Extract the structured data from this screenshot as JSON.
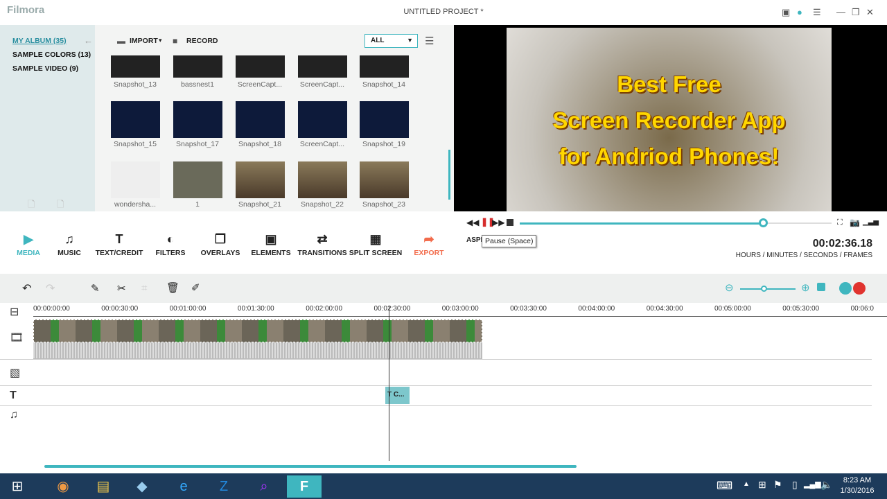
{
  "app": {
    "logo": "Filmora",
    "title": "UNTITLED PROJECT *"
  },
  "sidebar": {
    "items": [
      {
        "label": "MY ALBUM (35)"
      },
      {
        "label": "SAMPLE COLORS (13)"
      },
      {
        "label": "SAMPLE VIDEO (9)"
      }
    ]
  },
  "media": {
    "import_label": "IMPORT",
    "record_label": "RECORD",
    "filter_value": "ALL",
    "items": [
      {
        "label": "Snapshot_13"
      },
      {
        "label": "bassnest1"
      },
      {
        "label": "ScreenCapt..."
      },
      {
        "label": "ScreenCapt..."
      },
      {
        "label": "Snapshot_14"
      },
      {
        "label": "Snapshot_15"
      },
      {
        "label": "Snapshot_17"
      },
      {
        "label": "Snapshot_18"
      },
      {
        "label": "ScreenCapt..."
      },
      {
        "label": "Snapshot_19"
      },
      {
        "label": "wondersha..."
      },
      {
        "label": "1"
      },
      {
        "label": "Snapshot_21"
      },
      {
        "label": "Snapshot_22"
      },
      {
        "label": "Snapshot_23"
      }
    ]
  },
  "preview": {
    "line1": "Best Free",
    "line2": "Screen Recorder App",
    "line3": "for Andriod Phones!",
    "progress": 0.78
  },
  "playback": {
    "aspect_label": "ASPE",
    "tooltip": "Pause (Space)",
    "timecode": "00:02:36.18",
    "timecode_label": "HOURS / MINUTES / SECONDS / FRAMES"
  },
  "tools": [
    {
      "label": "MEDIA",
      "icon": "▶"
    },
    {
      "label": "MUSIC",
      "icon": "♫"
    },
    {
      "label": "TEXT/CREDIT",
      "icon": "T"
    },
    {
      "label": "FILTERS",
      "icon": "◐"
    },
    {
      "label": "OVERLAYS",
      "icon": "❐"
    },
    {
      "label": "ELEMENTS",
      "icon": "▣"
    },
    {
      "label": "TRANSITIONS",
      "icon": "⇄"
    },
    {
      "label": "SPLIT SCREEN",
      "icon": "▦"
    },
    {
      "label": "EXPORT",
      "icon": "➦"
    }
  ],
  "ruler": [
    "00:00:00:00",
    "00:00:30:00",
    "00:01:00:00",
    "00:01:30:00",
    "00:02:00:00",
    "00:02:30:00",
    "00:03:00:00",
    "00:03:30:00",
    "00:04:00:00",
    "00:04:30:00",
    "00:05:00:00",
    "00:05:30:00",
    "00:06:0"
  ],
  "text_clip": "T C...",
  "taskbar": {
    "time": "8:23 AM",
    "date": "1/30/2016"
  },
  "colors": {
    "accent": "#3fb6bf",
    "export": "#f26b4b"
  }
}
